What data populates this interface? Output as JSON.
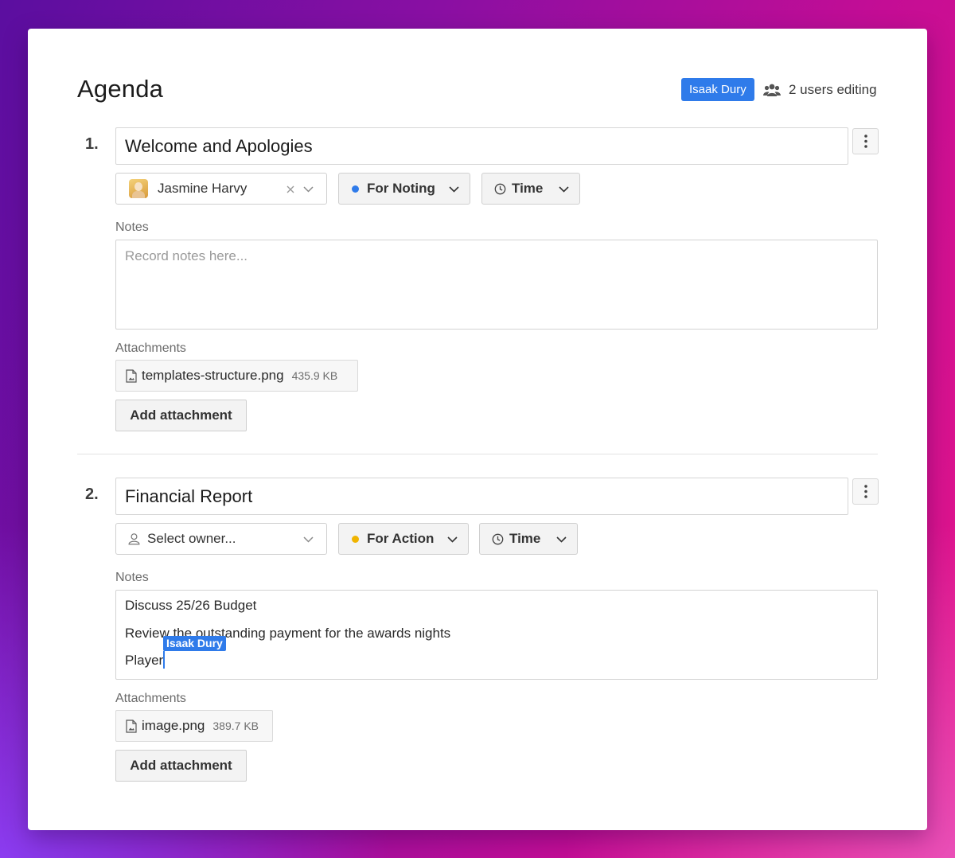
{
  "header": {
    "title": "Agenda",
    "active_user": "Isaak Dury",
    "editing_text": "2 users editing"
  },
  "items": [
    {
      "number": "1.",
      "title": "Welcome and Apologies",
      "owner": "Jasmine Harvy",
      "status": "For Noting",
      "status_color": "#2f7bea",
      "time_label": "Time",
      "notes_label": "Notes",
      "notes_placeholder": "Record notes here...",
      "attachments_label": "Attachments",
      "attachment_name": "templates-structure.png",
      "attachment_size": "435.9 KB",
      "add_attachment_label": "Add attachment"
    },
    {
      "number": "2.",
      "title": "Financial Report",
      "owner_placeholder": "Select owner...",
      "status": "For Action",
      "status_color": "#f0b400",
      "time_label": "Time",
      "notes_label": "Notes",
      "notes_lines": [
        "Discuss 25/26 Budget",
        "Review the outstanding payment for the awards nights",
        "Player"
      ],
      "cursor_user": "Isaak Dury",
      "attachments_label": "Attachments",
      "attachment_name": "image.png",
      "attachment_size": "389.7 KB",
      "add_attachment_label": "Add attachment"
    }
  ],
  "icons": {
    "users": "users-icon",
    "kebab": "more-vertical-icon",
    "clock": "clock-icon",
    "chevron": "chevron-down-icon",
    "clear": "close-icon",
    "file": "file-image-icon",
    "user": "user-icon"
  }
}
